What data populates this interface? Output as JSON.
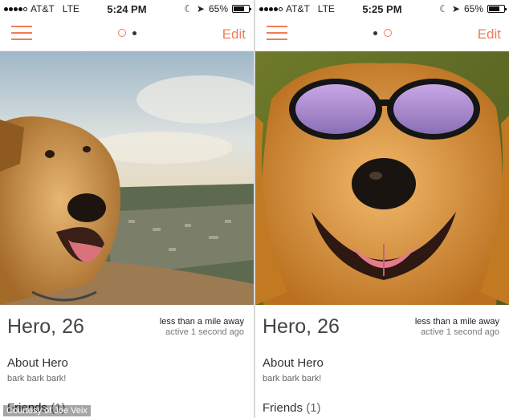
{
  "screens": [
    {
      "status": {
        "carrier": "AT&T",
        "network": "LTE",
        "time": "5:24 PM",
        "battery": "65%",
        "battery_fraction": 0.65
      },
      "nav": {
        "edit_label": "Edit",
        "active_page": 1
      },
      "profile": {
        "name": "Hero, 26",
        "distance": "less than a mile away",
        "active": "active 1 second ago",
        "about_title": "About Hero",
        "about_text": "bark bark bark!",
        "friends_label": "Friends",
        "friends_count": "(1)"
      }
    },
    {
      "status": {
        "carrier": "AT&T",
        "network": "LTE",
        "time": "5:25 PM",
        "battery": "65%",
        "battery_fraction": 0.65
      },
      "nav": {
        "edit_label": "Edit",
        "active_page": 2
      },
      "profile": {
        "name": "Hero, 26",
        "distance": "less than a mile away",
        "active": "active 1 second ago",
        "about_title": "About Hero",
        "about_text": "bark bark bark!",
        "friends_label": "Friends",
        "friends_count": "(1)"
      }
    }
  ],
  "credit": "Courtesy of Joe Veix",
  "colors": {
    "accent": "#f37b58"
  }
}
